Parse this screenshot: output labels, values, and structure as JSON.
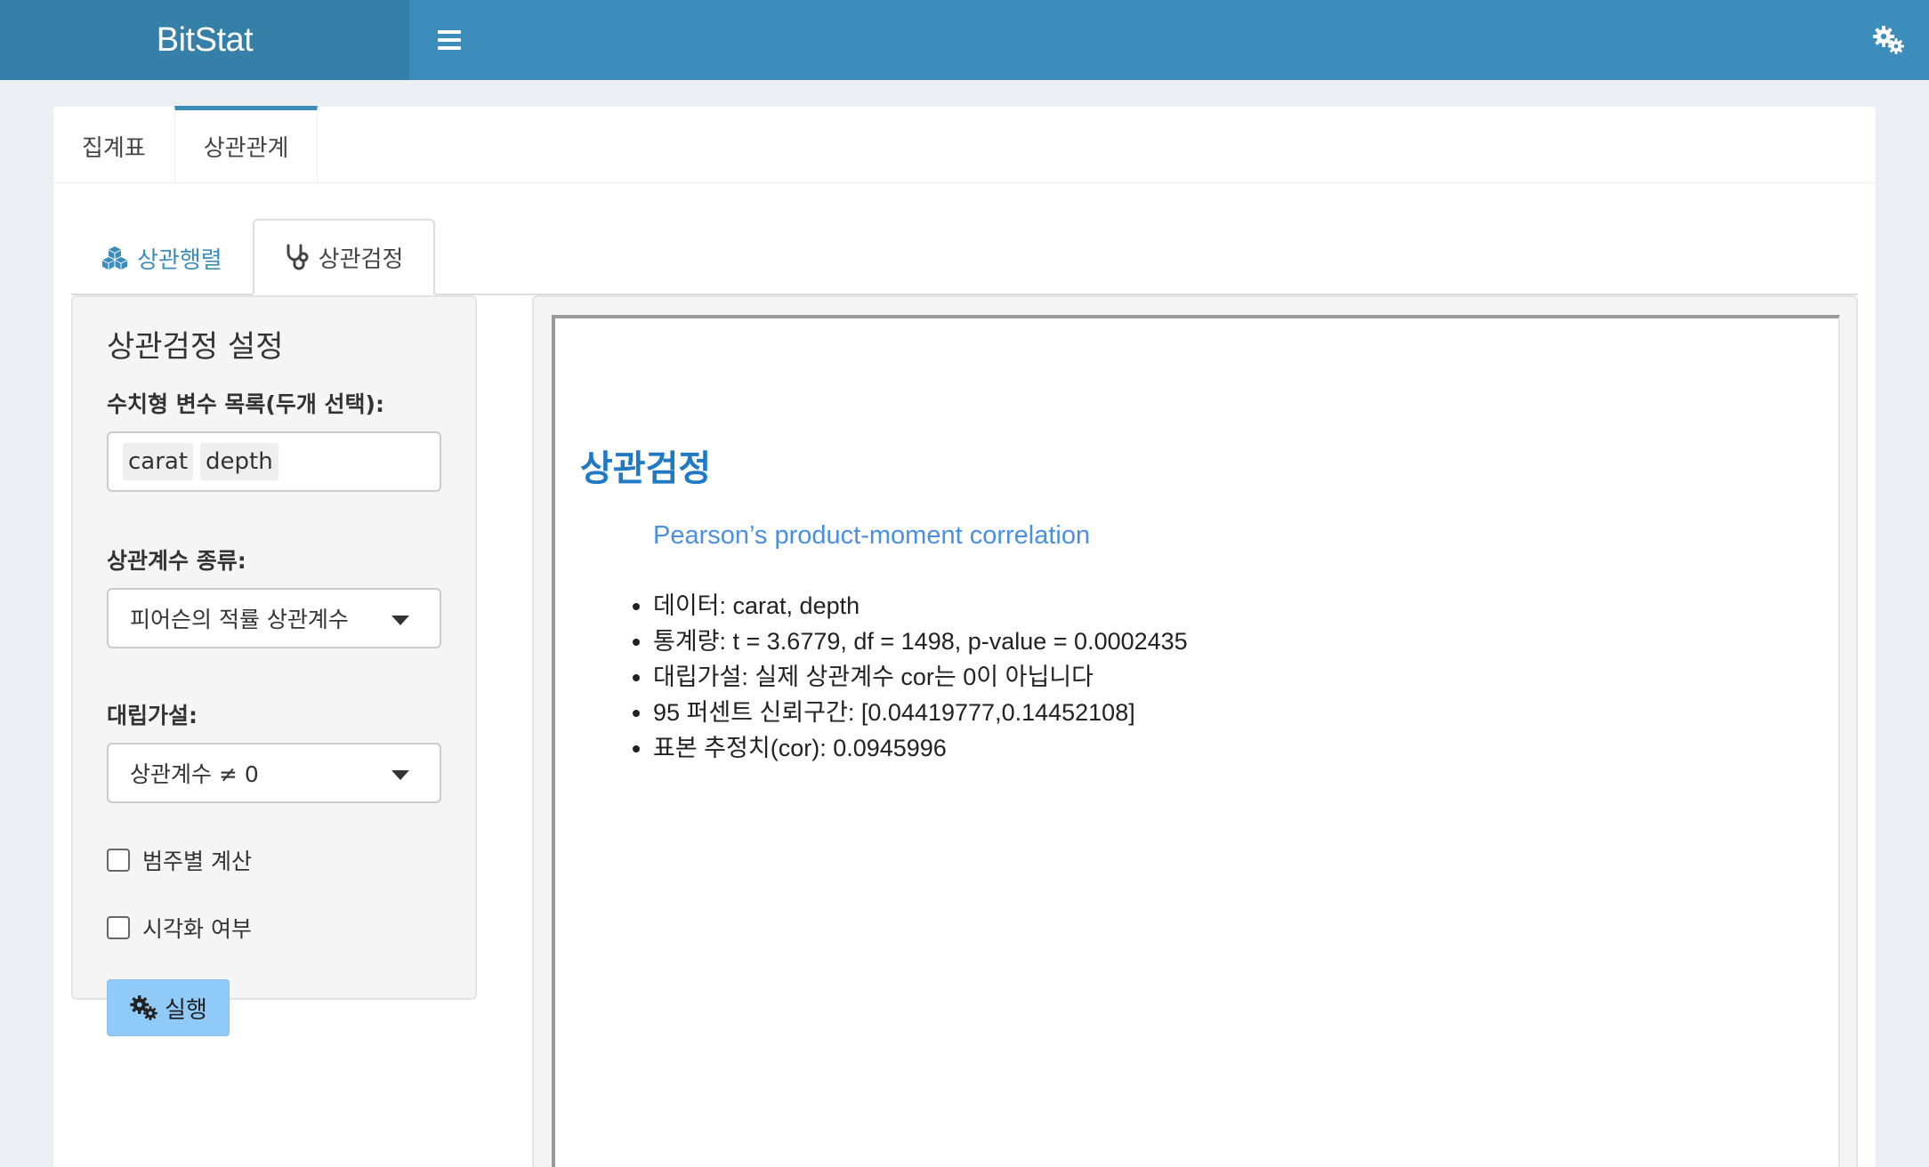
{
  "header": {
    "logo": "BitStat",
    "menu_icon": "bars-icon",
    "settings_icon": "cogs-icon",
    "colors": {
      "header": "#3c8dbc",
      "logo_bg": "#367fa9"
    }
  },
  "top_tabs": [
    {
      "label": "집계표"
    },
    {
      "label": "상관관계",
      "active": true
    }
  ],
  "sub_tabs": [
    {
      "label": "상관행렬",
      "icon": "cubes-icon"
    },
    {
      "label": "상관검정",
      "icon": "stethoscope-icon",
      "active": true
    }
  ],
  "settings": {
    "title": "상관검정 설정",
    "variables_label": "수치형 변수 목록(두개 선택):",
    "variables": [
      "carat",
      "depth"
    ],
    "method_label": "상관계수 종류:",
    "method_value": "피어슨의 적률 상관계수",
    "alternative_label": "대립가설:",
    "alternative_value": "상관계수 ≠ 0",
    "by_group_label": "범주별 계산",
    "by_group_checked": false,
    "visualize_label": "시각화 여부",
    "visualize_checked": false,
    "run_label": "실행",
    "run_color": "#90caf9"
  },
  "output": {
    "title": "상관검정",
    "method": "Pearson’s product-moment correlation",
    "items": [
      "데이터: carat, depth",
      "통계량: t = 3.6779, df = 1498, p-value = 0.0002435",
      "대립가설: 실제 상관계수 cor는 0이 아닙니다",
      "95 퍼센트 신뢰구간: [0.04419777,0.14452108]",
      "표본 추정치(cor): 0.0945996"
    ]
  }
}
